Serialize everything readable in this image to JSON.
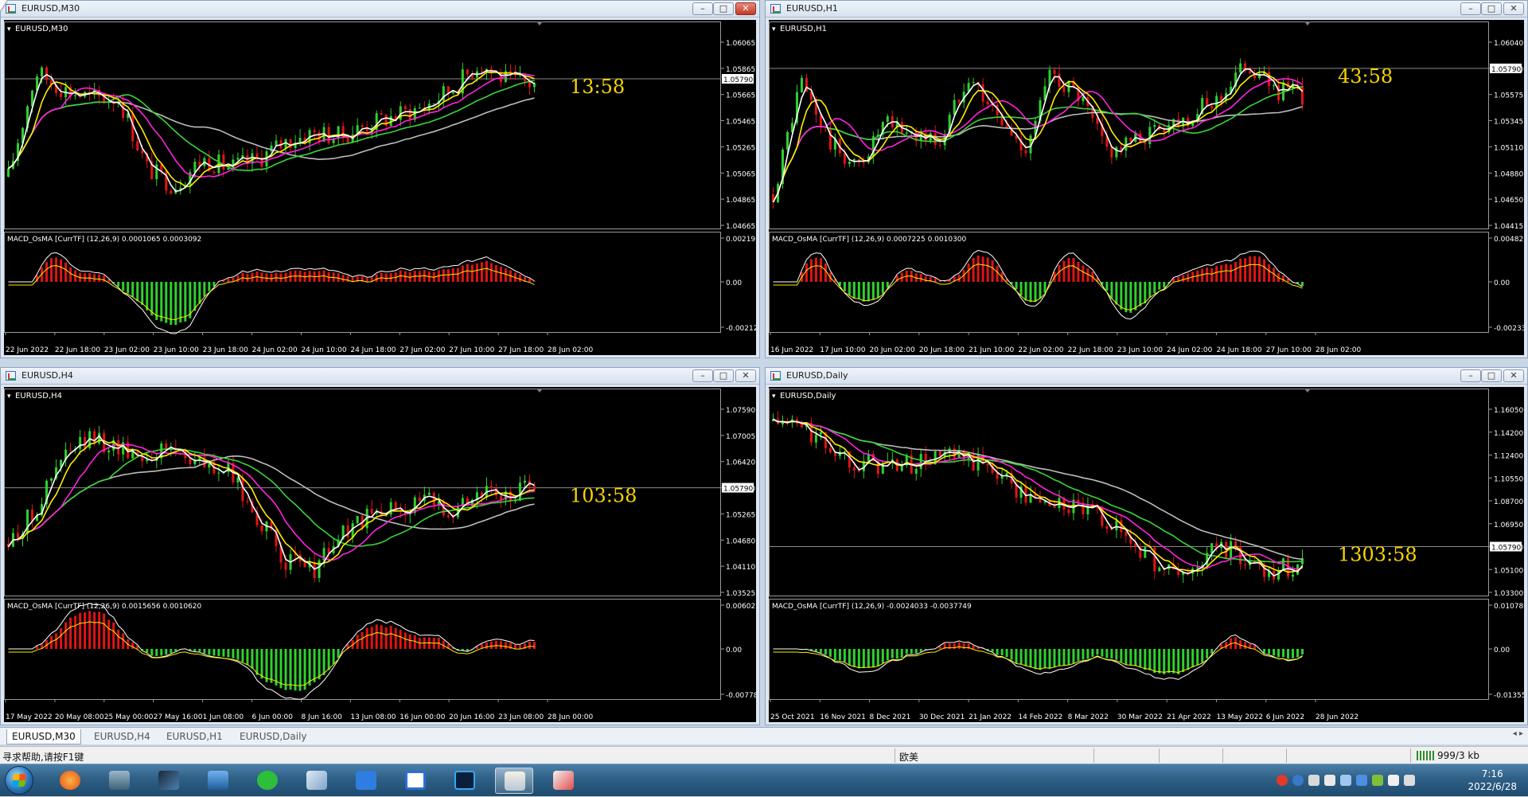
{
  "windows": [
    {
      "id": "m30",
      "title": "EURUSD,M30",
      "chart_label": "EURUSD,M30",
      "active": true,
      "countdown": "13:58",
      "price_ticks": [
        "1.06065",
        "1.05865",
        "1.05665",
        "1.05465",
        "1.05265",
        "1.05065",
        "1.04865",
        "1.04665"
      ],
      "current_price": "1.05790",
      "macd_label": "MACD_OsMA [CurrTF] (12,26,9) 0.0001065 0.0003092",
      "macd_ticks": [
        "0.002193",
        "0.00",
        "-0.002127"
      ],
      "time_ticks": [
        "22 Jun 2022",
        "22 Jun 18:00",
        "23 Jun 02:00",
        "23 Jun 10:00",
        "23 Jun 18:00",
        "24 Jun 02:00",
        "24 Jun 10:00",
        "24 Jun 18:00",
        "27 Jun 02:00",
        "27 Jun 10:00",
        "27 Jun 18:00",
        "28 Jun 02:00"
      ]
    },
    {
      "id": "h1",
      "title": "EURUSD,H1",
      "chart_label": "EURUSD,H1",
      "active": false,
      "countdown": "43:58",
      "price_ticks": [
        "1.06040",
        "1.05790",
        "1.05575",
        "1.05345",
        "1.05110",
        "1.04880",
        "1.04650",
        "1.04415"
      ],
      "current_price": "1.05790",
      "macd_label": "MACD_OsMA [CurrTF] (12,26,9) 0.0007225 0.0010300",
      "macd_ticks": [
        "0.0048279",
        "0.00",
        "-0.002336"
      ],
      "time_ticks": [
        "16 Jun 2022",
        "17 Jun 10:00",
        "20 Jun 02:00",
        "20 Jun 18:00",
        "21 Jun 10:00",
        "22 Jun 02:00",
        "22 Jun 18:00",
        "23 Jun 10:00",
        "24 Jun 02:00",
        "24 Jun 18:00",
        "27 Jun 10:00",
        "28 Jun 02:00"
      ]
    },
    {
      "id": "h4",
      "title": "EURUSD,H4",
      "chart_label": "EURUSD,H4",
      "active": false,
      "countdown": "103:58",
      "price_ticks": [
        "1.07590",
        "1.07005",
        "1.06420",
        "1.05790",
        "1.05265",
        "1.04680",
        "1.04110",
        "1.03525"
      ],
      "current_price": "1.05790",
      "macd_label": "MACD_OsMA [CurrTF] (12,26,9) 0.0015656 0.0010620",
      "macd_ticks": [
        "0.0060256",
        "0.00",
        "-0.007783"
      ],
      "time_ticks": [
        "17 May 2022",
        "20 May 08:00",
        "25 May 00:00",
        "27 May 16:00",
        "1 Jun 08:00",
        "6 Jun 00:00",
        "8 Jun 16:00",
        "13 Jun 08:00",
        "16 Jun 00:00",
        "20 Jun 16:00",
        "23 Jun 08:00",
        "28 Jun 00:00"
      ]
    },
    {
      "id": "d1",
      "title": "EURUSD,Daily",
      "chart_label": "EURUSD,Daily",
      "active": false,
      "countdown": "1303:58",
      "price_ticks": [
        "1.16050",
        "1.14200",
        "1.12400",
        "1.10550",
        "1.08700",
        "1.06950",
        "1.05790",
        "1.05100",
        "1.03300"
      ],
      "current_price": "1.05790",
      "macd_label": "MACD_OsMA [CurrTF] (12,26,9) -0.0024033 -0.0037749",
      "macd_ticks": [
        "0.0107807",
        "0.00",
        "-0.0135571"
      ],
      "time_ticks": [
        "25 Oct 2021",
        "16 Nov 2021",
        "8 Dec 2021",
        "30 Dec 2021",
        "21 Jan 2022",
        "14 Feb 2022",
        "8 Mar 2022",
        "30 Mar 2022",
        "21 Apr 2022",
        "13 May 2022",
        "6 Jun 2022",
        "28 Jun 2022"
      ]
    }
  ],
  "tabs": [
    "EURUSD,M30",
    "EURUSD,H4",
    "EURUSD,H1",
    "EURUSD,Daily"
  ],
  "active_tab": "EURUSD,M30",
  "status": {
    "help": "寻求帮助,请按F1键",
    "profile": "欧美",
    "traffic": "999/3 kb"
  },
  "taskbar": {
    "apps": [
      "start",
      "app-orange",
      "app-tools",
      "app-z",
      "app-monitor",
      "app-wechat",
      "app-notes",
      "app-blue-pen",
      "app-baidu",
      "photoshop",
      "mt4-active",
      "app-paint"
    ],
    "clock_time": "7:16",
    "clock_date": "2022/6/28"
  },
  "colors": {
    "bull": "#2fd12f",
    "bear": "#e11414",
    "ma_white": "#ffffff",
    "ma_yellow": "#ffee00",
    "ma_magenta": "#ff22dd",
    "ma_green": "#39d339",
    "ma_gray": "#bdbdbd",
    "countdown": "#f5d400"
  }
}
